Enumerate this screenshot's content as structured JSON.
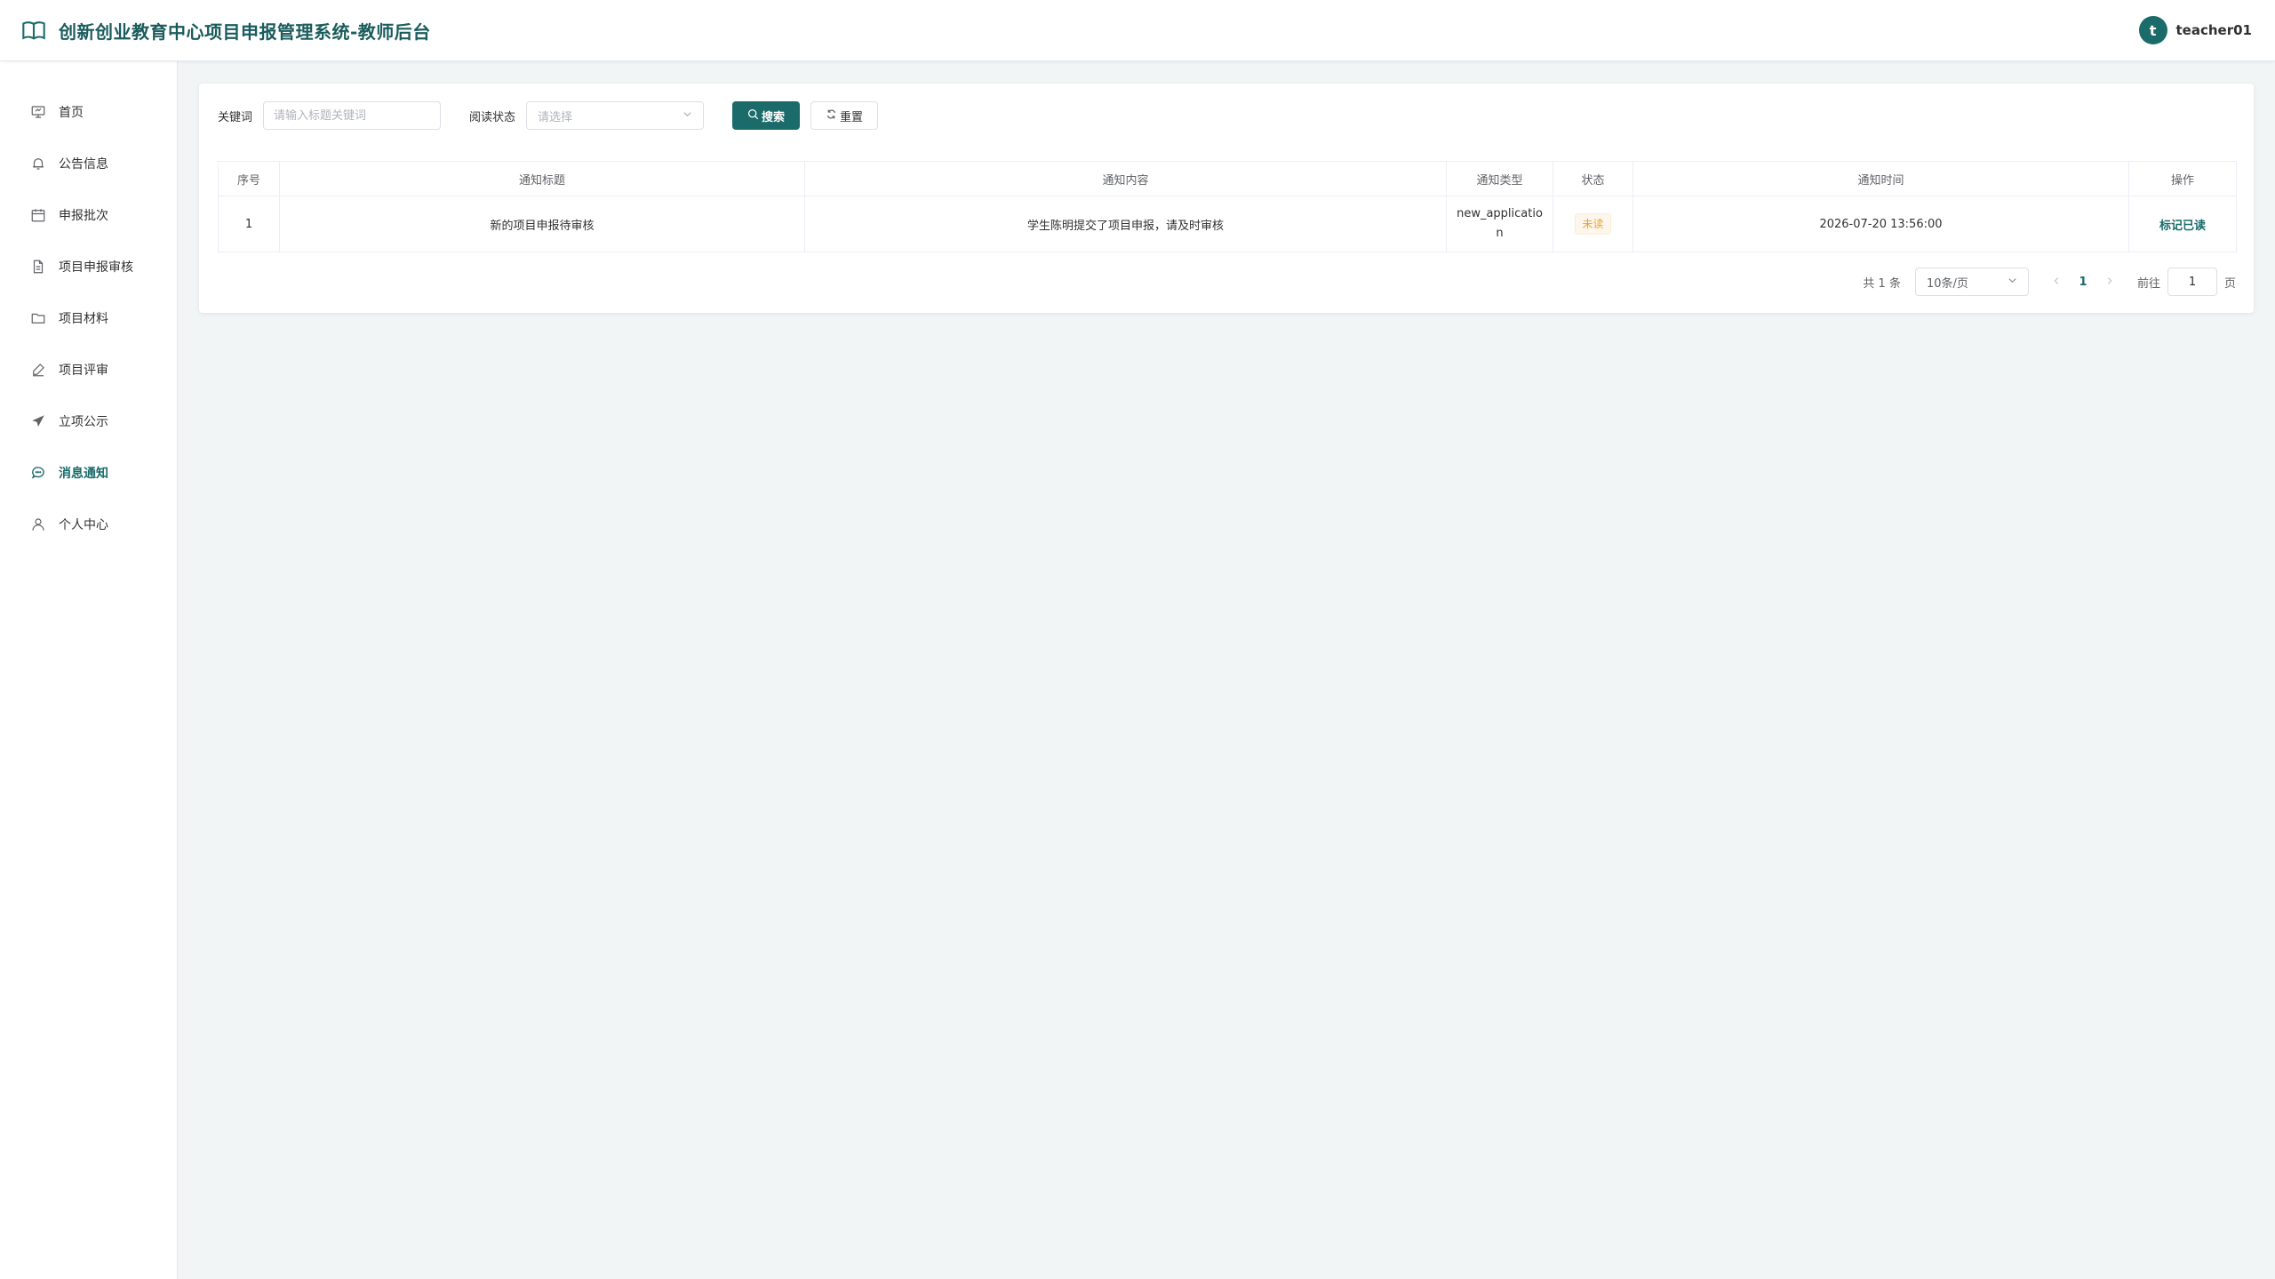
{
  "header": {
    "title": "创新创业教育中心项目申报管理系统-教师后台",
    "avatar_letter": "t",
    "username": "teacher01",
    "brand_color": "#1b6b6b"
  },
  "sidebar": {
    "items": [
      {
        "label": "首页",
        "icon": "home-icon"
      },
      {
        "label": "公告信息",
        "icon": "bell-icon"
      },
      {
        "label": "申报批次",
        "icon": "calendar-icon"
      },
      {
        "label": "项目申报审核",
        "icon": "document-icon"
      },
      {
        "label": "项目材料",
        "icon": "folder-icon"
      },
      {
        "label": "项目评审",
        "icon": "edit-pen-icon"
      },
      {
        "label": "立项公示",
        "icon": "send-icon"
      },
      {
        "label": "消息通知",
        "icon": "chat-icon",
        "active": true
      },
      {
        "label": "个人中心",
        "icon": "user-icon"
      }
    ]
  },
  "filters": {
    "keyword_label": "关键词",
    "keyword_placeholder": "请输入标题关键词",
    "keyword_value": "",
    "read_status_label": "阅读状态",
    "read_status_placeholder": "请选择",
    "search_button": "搜索",
    "reset_button": "重置"
  },
  "table": {
    "columns": [
      "序号",
      "通知标题",
      "通知内容",
      "通知类型",
      "状态",
      "通知时间",
      "操作"
    ],
    "rows": [
      {
        "index": "1",
        "title": "新的项目申报待审核",
        "content": "学生陈明提交了项目申报，请及时审核",
        "type": "new_application",
        "status": "未读",
        "time": "2026-07-20 13:56:00",
        "action": "标记已读"
      }
    ]
  },
  "pagination": {
    "total_text": "共 1 条",
    "page_size": "10条/页",
    "current_page": "1",
    "goto_label": "前往",
    "goto_value": "1",
    "page_suffix": "页"
  }
}
